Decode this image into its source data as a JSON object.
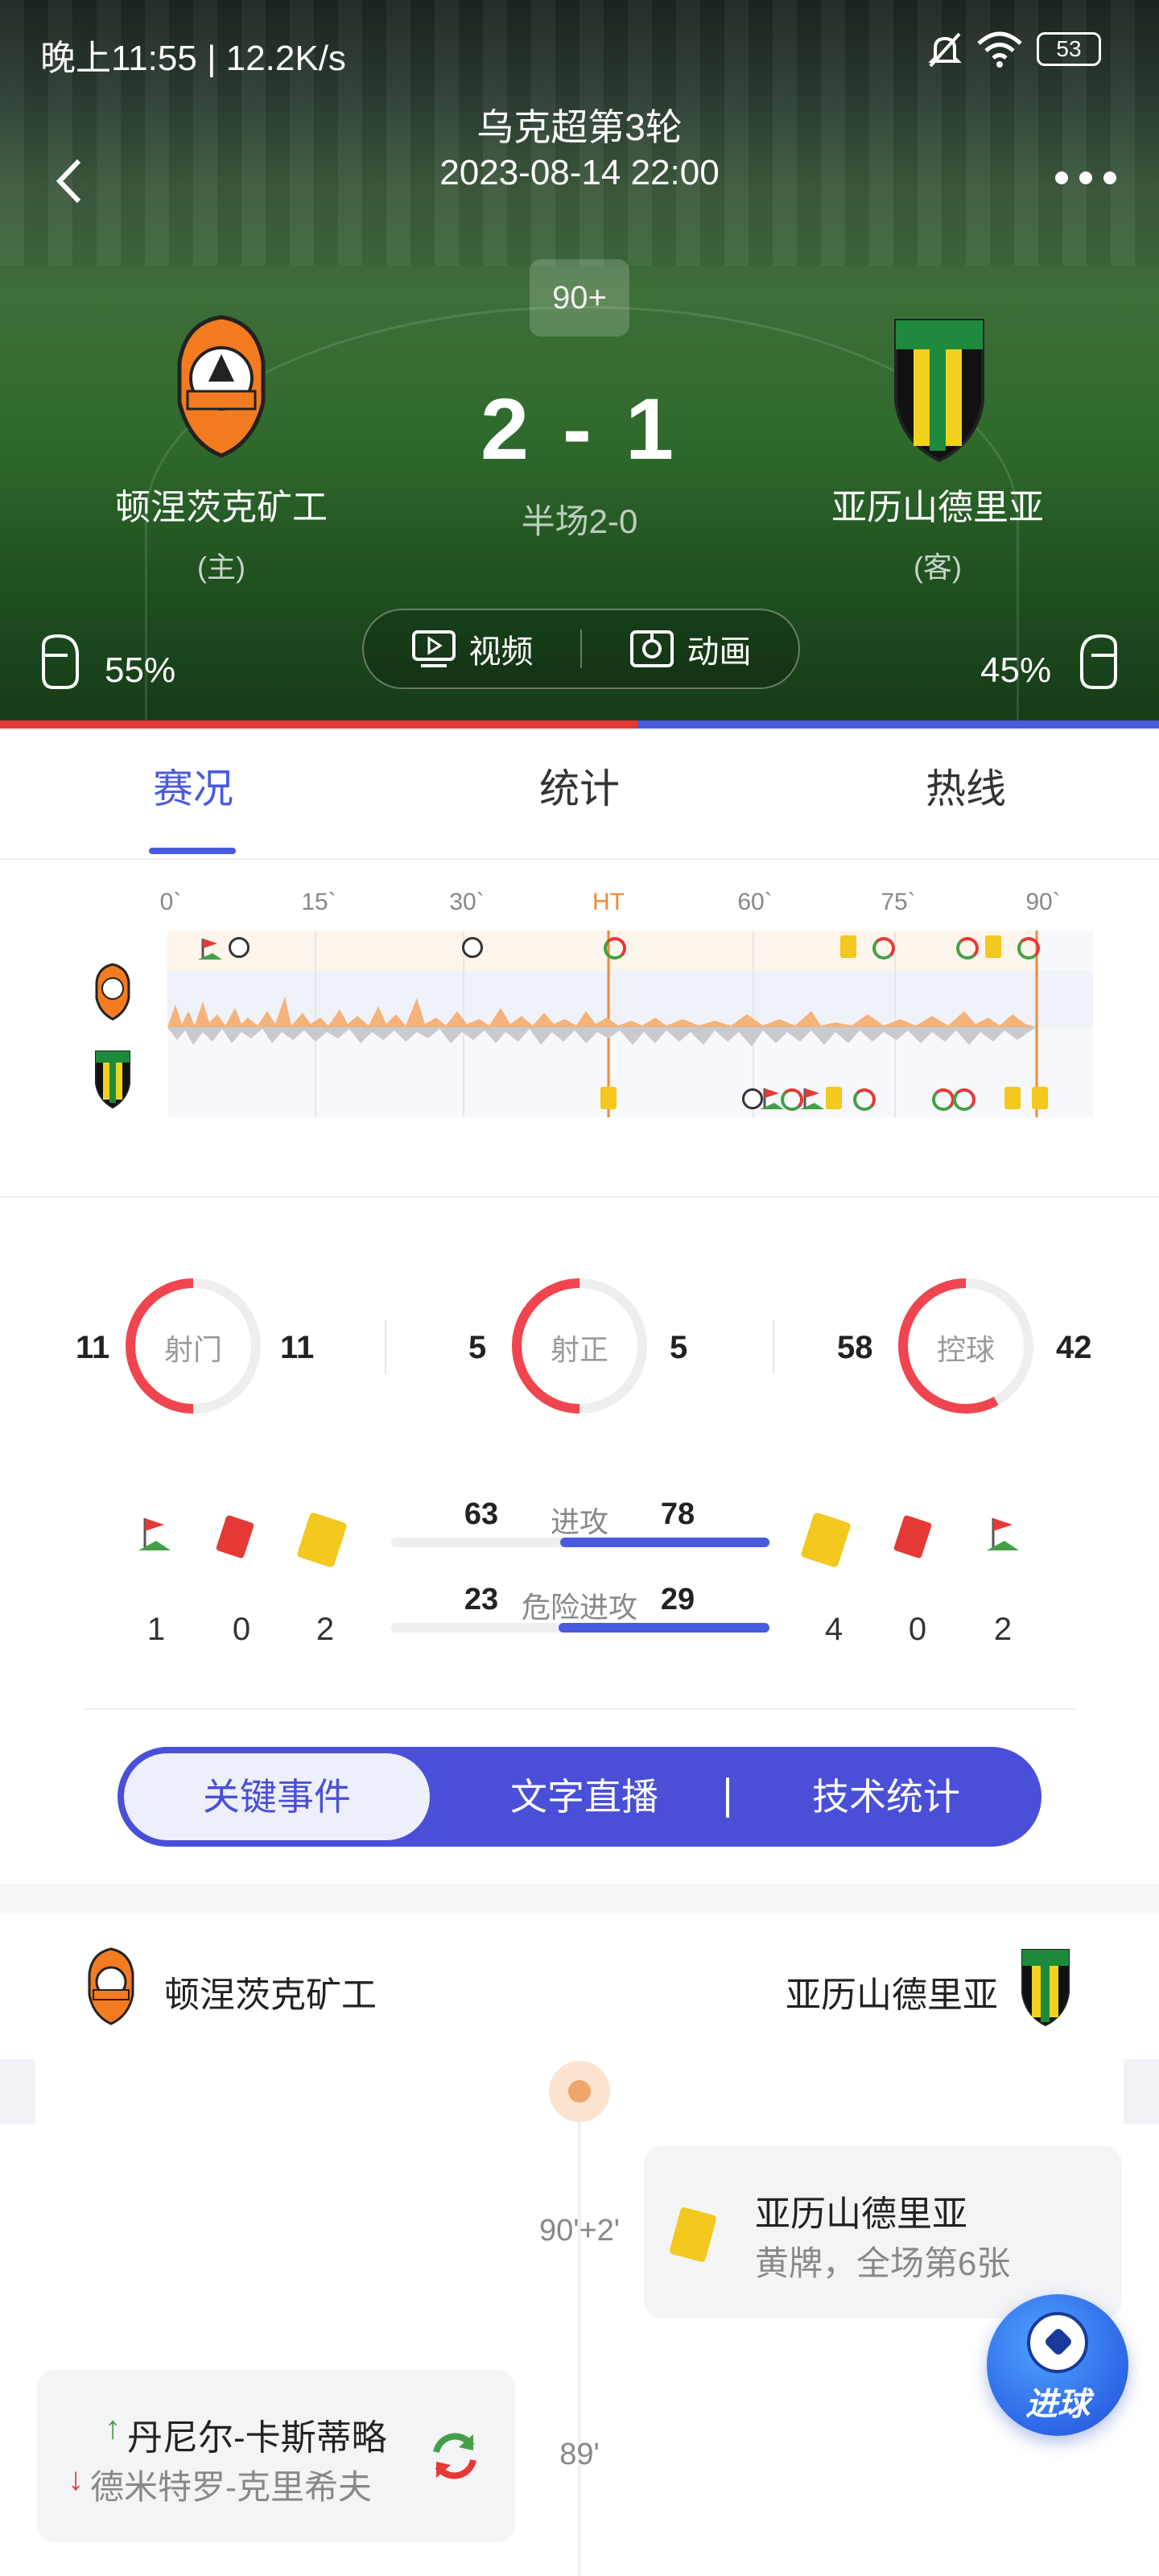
{
  "status_bar": {
    "time_speed": "晚上11:55 | 12.2K/s",
    "battery": "53"
  },
  "header": {
    "league_round": "乌克超第3轮",
    "datetime": "2023-08-14 22:00",
    "minute": "90+",
    "home": {
      "name": "顿涅茨克矿工",
      "role": "(主)",
      "possession": "55%"
    },
    "away": {
      "name": "亚历山德里亚",
      "role": "(客)",
      "possession": "45%"
    },
    "score": "2 - 1",
    "halftime": "半场2-0",
    "video_label": "视频",
    "animation_label": "动画",
    "colors": {
      "home": "#e53935",
      "away": "#4a5ae0"
    }
  },
  "tabs": [
    {
      "label": "赛况",
      "active": true
    },
    {
      "label": "统计",
      "active": false
    },
    {
      "label": "热线",
      "active": false
    }
  ],
  "timeline": {
    "ticks": [
      "0`",
      "15`",
      "30`",
      "HT",
      "60`",
      "75`",
      "90`"
    ]
  },
  "stats": {
    "shots": {
      "label": "射门",
      "home": "11",
      "away": "11",
      "home_share": 0.5
    },
    "on_target": {
      "label": "射正",
      "home": "5",
      "away": "5",
      "home_share": 0.5
    },
    "possession": {
      "label": "控球",
      "home": "58",
      "away": "42",
      "home_share": 0.58
    },
    "home_corners": "1",
    "home_red": "0",
    "home_yellow": "2",
    "away_yellow": "4",
    "away_red": "0",
    "away_corners": "2",
    "attack": {
      "label": "进攻",
      "home": "63",
      "away": "78"
    },
    "dangerous": {
      "label": "危险进攻",
      "home": "23",
      "away": "29"
    }
  },
  "segment": {
    "items": [
      "关键事件",
      "文字直播",
      "技术统计"
    ],
    "active": 0
  },
  "events_header": {
    "home": "顿涅茨克矿工",
    "away": "亚历山德里亚"
  },
  "events": [
    {
      "time": "90'+2'",
      "side": "away",
      "type": "yellow",
      "title": "亚历山德里亚",
      "desc": "黄牌，全场第6张"
    },
    {
      "time": "89'",
      "side": "home",
      "type": "sub",
      "in": "丹尼尔-卡斯蒂略",
      "out": "德米特罗-克里希夫"
    }
  ],
  "fab": {
    "label": "进球"
  }
}
